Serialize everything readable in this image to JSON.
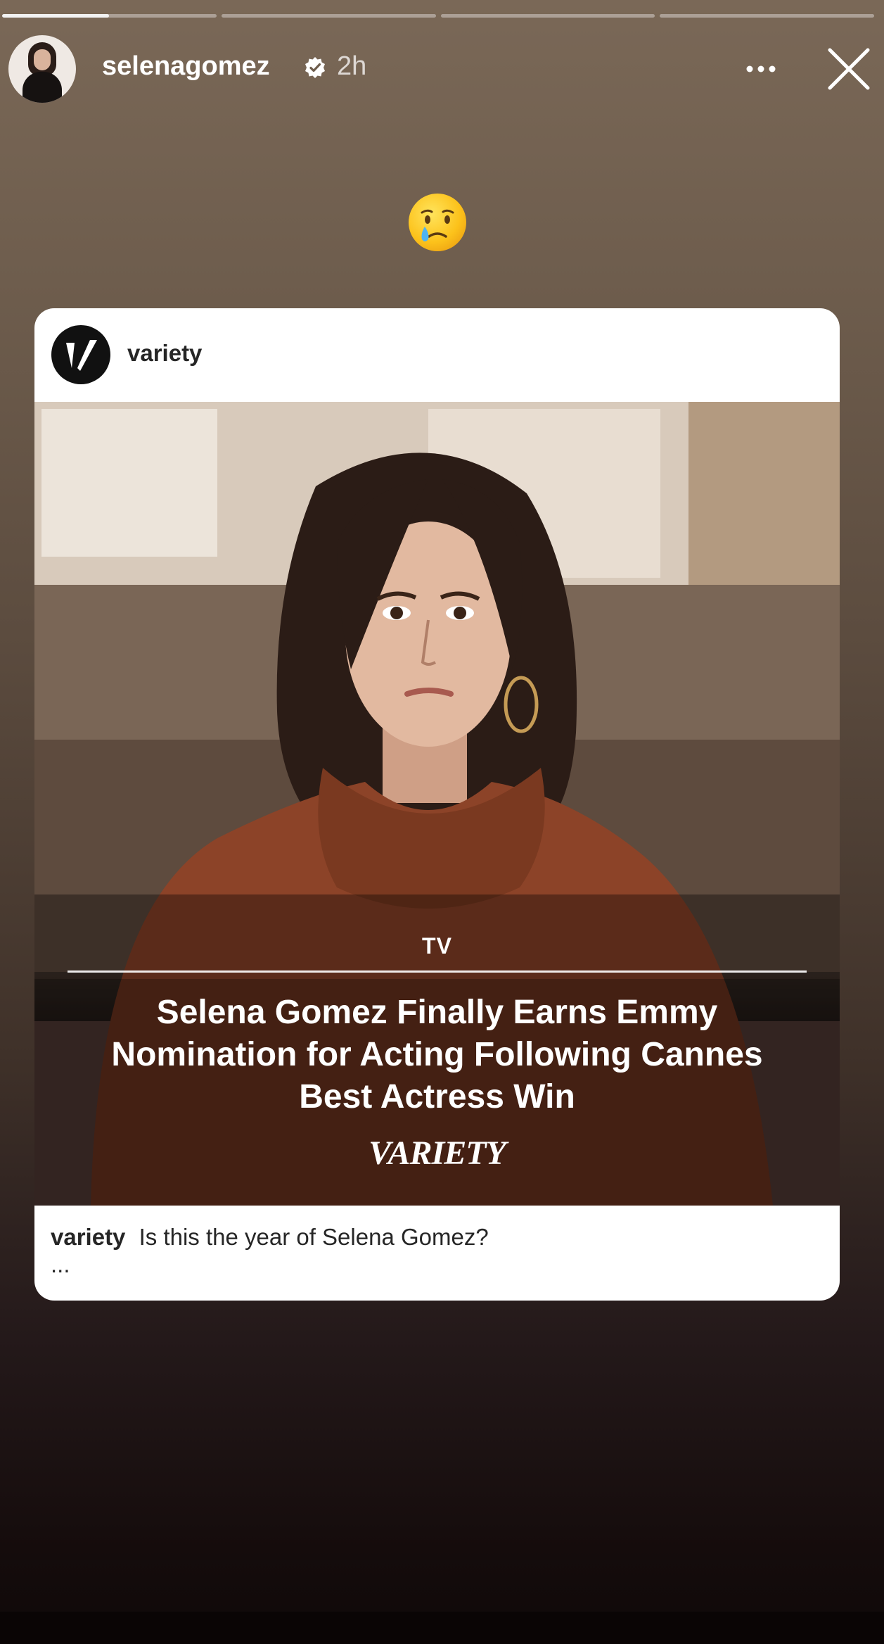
{
  "story": {
    "segments": [
      {
        "progress": 0.5
      },
      {
        "progress": 0
      },
      {
        "progress": 0
      },
      {
        "progress": 0
      }
    ],
    "username": "selenagomez",
    "verified": true,
    "time": "2h",
    "sticker_emoji": "face-holding-back-tears"
  },
  "shared_post": {
    "username": "variety",
    "image": {
      "kicker": "TV",
      "headline": "Selena Gomez Finally Earns Emmy Nomination for Acting Following Cannes Best Actress Win",
      "brand": "VARIETY"
    },
    "caption": {
      "username": "variety",
      "text": "Is this the year of Selena Gomez?",
      "more": "..."
    }
  },
  "colors": {
    "progress_fill": "#f2f2f2",
    "card_bg": "#ffffff",
    "sweater": "#8c4328"
  }
}
